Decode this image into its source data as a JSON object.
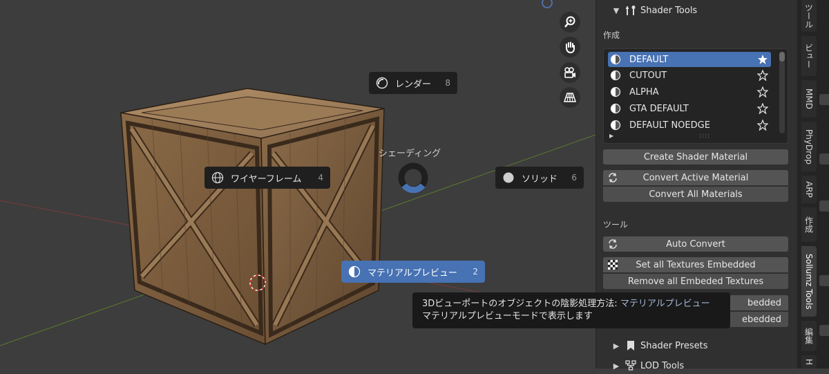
{
  "viewport": {
    "pie_title": "シェーディング",
    "pie_items": [
      {
        "label": "レンダー",
        "key": "8"
      },
      {
        "label": "ワイヤーフレーム",
        "key": "4"
      },
      {
        "label": "ソリッド",
        "key": "6"
      },
      {
        "label": "マテリアルプレビュー",
        "key": "2"
      }
    ],
    "nav_icons": [
      "zoom-icon",
      "hand-pan-icon",
      "camera-icon",
      "grid-perspective-icon"
    ],
    "tooltip": {
      "line1_prefix": "3Dビューポートのオブジェクトの陰影処理方法:",
      "line1_value": "マテリアルプレビュー",
      "line2": "マテリアルプレビューモードで表示します"
    }
  },
  "sidebar": {
    "shader_tools": {
      "title": "Shader Tools",
      "create_label": "作成",
      "list": [
        {
          "label": "DEFAULT",
          "starred": true
        },
        {
          "label": "CUTOUT",
          "starred": false
        },
        {
          "label": "ALPHA",
          "starred": false
        },
        {
          "label": "GTA DEFAULT",
          "starred": false
        },
        {
          "label": "DEFAULT NOEDGE",
          "starred": false
        }
      ],
      "list_grip": "::::",
      "create_button": "Create Shader Material",
      "convert_active": "Convert Active Material",
      "convert_all": "Convert All Materials",
      "tools_label": "ツール",
      "auto_convert": "Auto Convert",
      "set_embedded": "Set all Textures Embedded",
      "remove_embedded": "Remove all Embeded Textures",
      "hidden_btn1_tail": "bedded",
      "hidden_btn2_tail": "ebedded"
    },
    "shader_presets": "Shader Presets",
    "lod_tools": "LOD Tools"
  },
  "tabs": [
    "ツール",
    "ビュー",
    "MMD",
    "PhyDrop",
    "ARP",
    "作成",
    "Sollumz Tools",
    "編集",
    "H"
  ],
  "colors": {
    "accent": "#4772b3",
    "panel": "#303030",
    "button": "#545454",
    "viewport": "#3d3d3d"
  }
}
